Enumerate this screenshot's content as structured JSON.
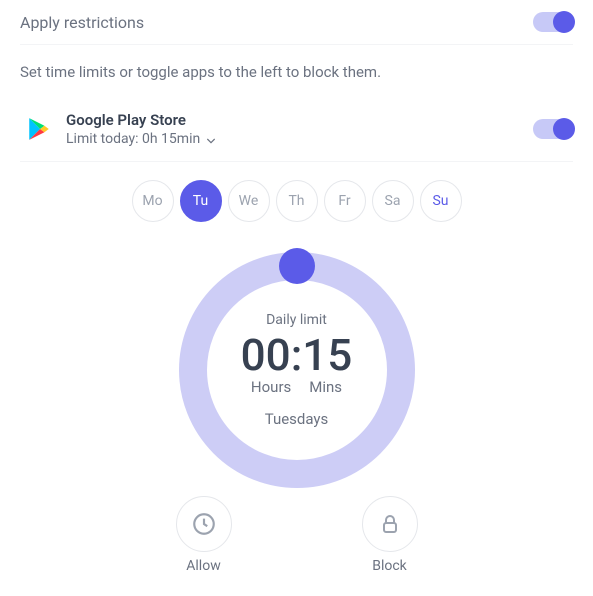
{
  "header": {
    "title": "Apply restrictions",
    "toggle_on": true
  },
  "description": "Set time limits or toggle apps to the left to block them.",
  "app": {
    "name": "Google Play Store",
    "limit_text": "Limit today: 0h 15min",
    "toggle_on": true
  },
  "days": [
    {
      "short": "Mo",
      "active": false,
      "today": false
    },
    {
      "short": "Tu",
      "active": true,
      "today": false
    },
    {
      "short": "We",
      "active": false,
      "today": false
    },
    {
      "short": "Th",
      "active": false,
      "today": false
    },
    {
      "short": "Fr",
      "active": false,
      "today": false
    },
    {
      "short": "Sa",
      "active": false,
      "today": false
    },
    {
      "short": "Su",
      "active": false,
      "today": true
    }
  ],
  "dial": {
    "label": "Daily limit",
    "time": "00:15",
    "hours_label": "Hours",
    "mins_label": "Mins",
    "day_label": "Tuesdays"
  },
  "actions": {
    "allow": "Allow",
    "block": "Block"
  }
}
